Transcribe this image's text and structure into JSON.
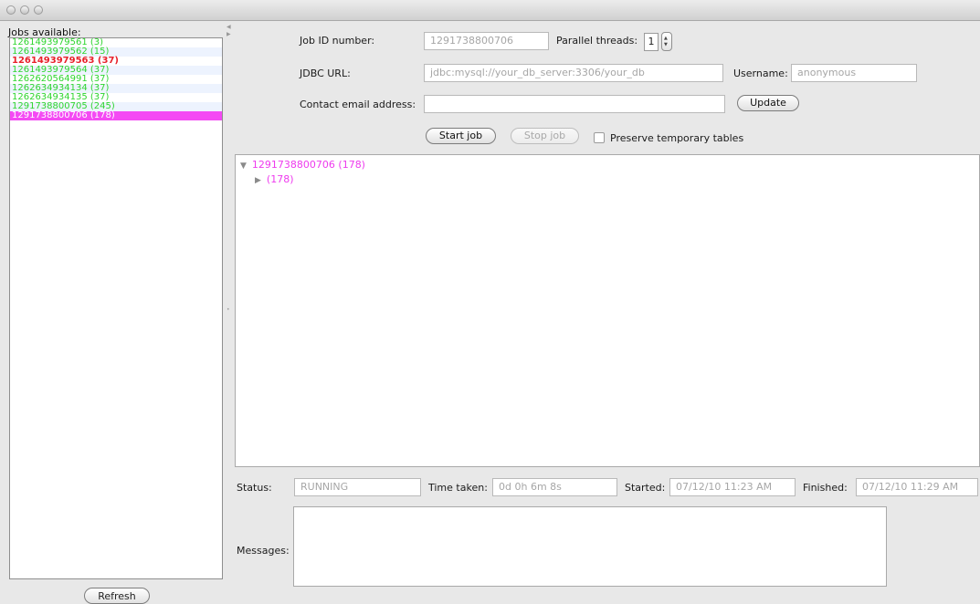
{
  "window": {
    "title": ""
  },
  "jobs_panel": {
    "label": "Jobs available:",
    "jobs": [
      {
        "text": "1261493979561 (3)",
        "state": "ok"
      },
      {
        "text": "1261493979562 (15)",
        "state": "ok"
      },
      {
        "text": "1261493979563 (37)",
        "state": "failed"
      },
      {
        "text": "1261493979564 (37)",
        "state": "ok"
      },
      {
        "text": "1262620564991 (37)",
        "state": "ok"
      },
      {
        "text": "1262634934134 (37)",
        "state": "ok"
      },
      {
        "text": "1262634934135 (37)",
        "state": "ok"
      },
      {
        "text": "1291738800705 (245)",
        "state": "ok"
      },
      {
        "text": "1291738800706 (178)",
        "state": "selected"
      }
    ],
    "refresh_label": "Refresh"
  },
  "form": {
    "job_id_label": "Job ID number:",
    "job_id_value": "1291738800706",
    "parallel_threads_label": "Parallel threads:",
    "parallel_threads_value": "1",
    "jdbc_url_label": "JDBC URL:",
    "jdbc_url_value": "jdbc:mysql://your_db_server:3306/your_db",
    "username_label": "Username:",
    "username_value": "anonymous",
    "contact_email_label": "Contact email address:",
    "contact_email_value": "",
    "update_label": "Update",
    "start_job_label": "Start job",
    "stop_job_label": "Stop job",
    "preserve_tables_label": "Preserve temporary tables",
    "preserve_tables_checked": false
  },
  "tree": {
    "root_label": "1291738800706 (178)",
    "child_label": "(178)"
  },
  "status": {
    "status_label": "Status:",
    "status_value": "RUNNING",
    "time_taken_label": "Time taken:",
    "time_taken_value": "0d 0h 6m 8s",
    "started_label": "Started:",
    "started_value": "07/12/10 11:23 AM",
    "finished_label": "Finished:",
    "finished_value": "07/12/10 11:29 AM",
    "messages_label": "Messages:",
    "messages_value": ""
  },
  "colors": {
    "job_ok": "#2ed52e",
    "job_failed": "#e8212b",
    "job_selected_bg": "#f44af4",
    "tree_text": "#ee3bee"
  }
}
